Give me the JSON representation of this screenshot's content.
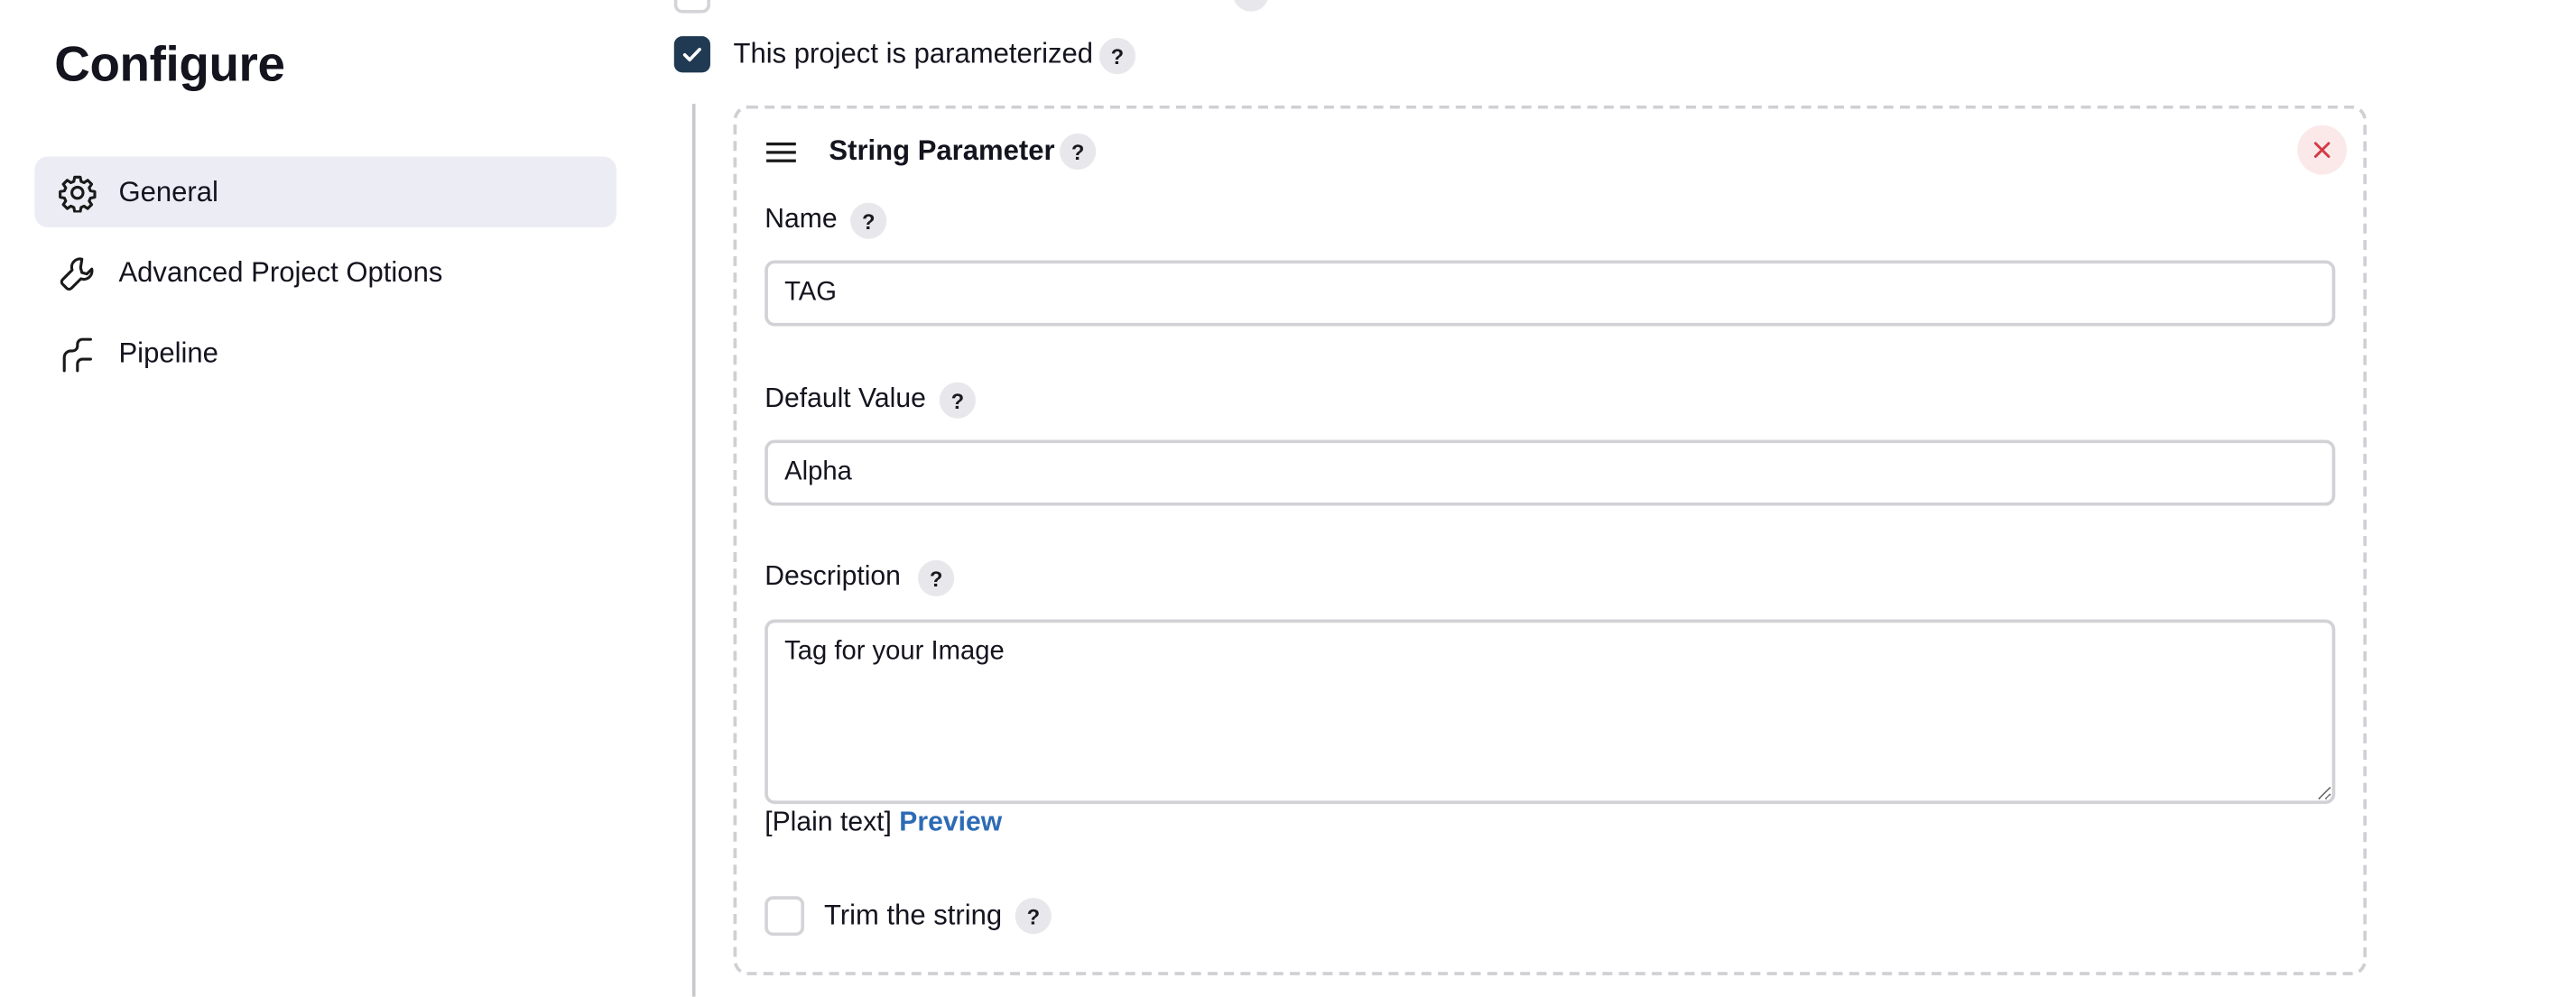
{
  "sidebar": {
    "title": "Configure",
    "items": [
      {
        "label": "General",
        "icon": "gear-icon",
        "active": true
      },
      {
        "label": "Advanced Project Options",
        "icon": "wrench-icon",
        "active": false
      },
      {
        "label": "Pipeline",
        "icon": "pipeline-icon",
        "active": false
      }
    ]
  },
  "options": {
    "parameterized_label": "This project is parameterized",
    "parameterized_checked": true,
    "help_glyph": "?"
  },
  "parameter": {
    "type_label": "String Parameter",
    "name_label": "Name",
    "name_value": "TAG",
    "default_label": "Default Value",
    "default_value": "Alpha",
    "description_label": "Description",
    "description_value": "Tag for your Image",
    "format_label": "[Plain text]",
    "preview_label": "Preview",
    "trim_label": "Trim the string",
    "trim_checked": false
  },
  "colors": {
    "accent": "#1f3a52",
    "link": "#2d6bb5",
    "close": "#d33c44",
    "nav_active_bg": "#ececf4"
  }
}
